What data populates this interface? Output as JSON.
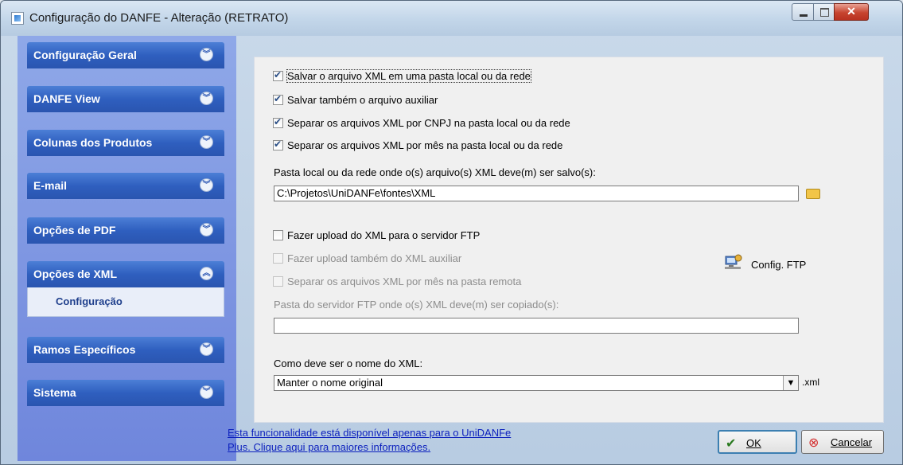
{
  "window": {
    "title": "Configuração do DANFE - Alteração  (RETRATO)",
    "controls": {
      "minimize": "–",
      "maximize": "□",
      "close": "✕"
    }
  },
  "sidebar": {
    "sections": [
      {
        "label": "Configuração Geral",
        "icon": "chevron-down-icon"
      },
      {
        "label": "DANFE View",
        "icon": "chevron-down-icon"
      },
      {
        "label": "Colunas dos Produtos",
        "icon": "chevron-down-icon"
      },
      {
        "label": "E-mail",
        "icon": "chevron-down-icon"
      },
      {
        "label": "Opções de PDF",
        "icon": "chevron-down-icon"
      },
      {
        "label": "Opções de XML",
        "icon": "chevron-up-icon",
        "expanded": true,
        "sub_items": [
          "Configuração"
        ]
      },
      {
        "label": "Ramos Específicos",
        "icon": "chevron-down-icon"
      },
      {
        "label": "Sistema",
        "icon": "chevron-down-icon"
      }
    ]
  },
  "form": {
    "save_local": {
      "label": "Salvar o arquivo XML em uma pasta local ou da rede",
      "checked": true
    },
    "save_aux": {
      "label": "Salvar também o arquivo auxiliar",
      "checked": true
    },
    "split_cnpj": {
      "label": "Separar os arquivos XML por CNPJ na pasta local ou da rede",
      "checked": true
    },
    "split_month": {
      "label": "Separar os arquivos XML por mês na pasta local ou da rede",
      "checked": true
    },
    "folder_label": "Pasta local ou da rede onde o(s) arquivo(s) XML deve(m) ser salvo(s):",
    "folder_value": "C:\\Projetos\\UniDANFe\\fontes\\XML",
    "ftp_upload": {
      "label": "Fazer upload do XML para o servidor FTP",
      "checked": false
    },
    "ftp_aux": {
      "label": "Fazer upload também do XML auxiliar",
      "checked": false,
      "disabled": true
    },
    "ftp_split_month": {
      "label": "Separar os arquivos XML por mês na pasta remota",
      "checked": false,
      "disabled": true
    },
    "ftp_config_label": "Config. FTP",
    "ftp_folder_label": "Pasta do servidor FTP onde o(s) XML deve(m) ser copiado(s):",
    "ftp_folder_value": "",
    "name_label": "Como deve ser o nome do XML:",
    "name_value": "Manter o nome original",
    "name_suffix": ".xml"
  },
  "footer": {
    "info_line1": "Esta funcionalidade está disponível apenas para o UniDANFe",
    "info_line2": "Plus. Clique aqui para maiores informações.",
    "ok_label": "OK",
    "cancel_label": "Cancelar"
  },
  "colors": {
    "sidebar_header": "#2f5fbf",
    "sidebar_bg": "#7f97e2",
    "link": "#0b1fbd",
    "close_button": "#c7442f"
  }
}
